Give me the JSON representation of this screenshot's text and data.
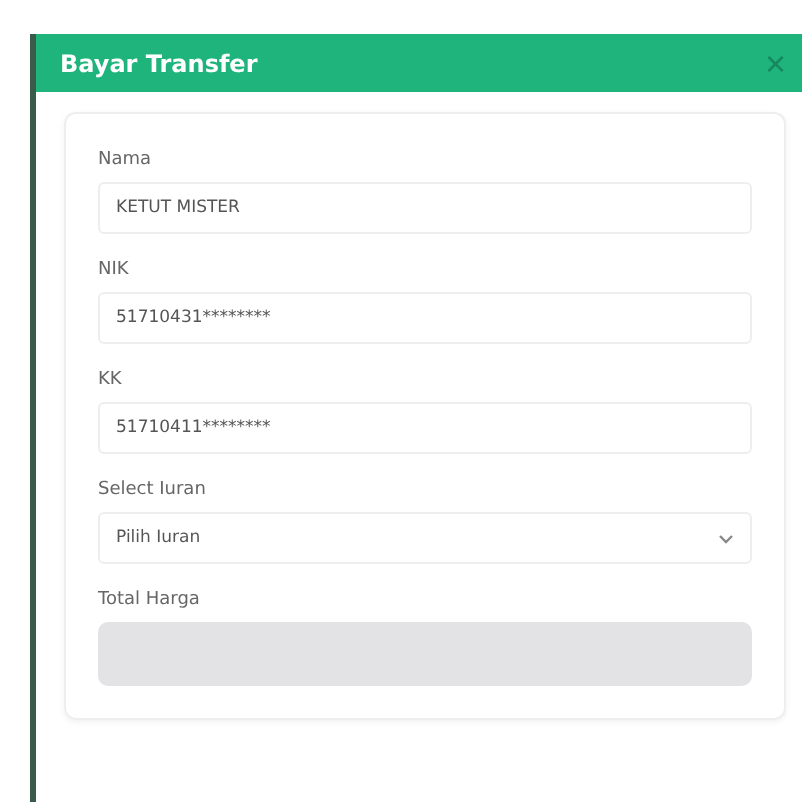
{
  "modal": {
    "title": "Bayar Transfer",
    "close": "×"
  },
  "fields": [
    {
      "kind": "text",
      "label": "Nama",
      "value": "KETUT MISTER"
    },
    {
      "kind": "text",
      "label": "NIK",
      "value": "51710431********"
    },
    {
      "kind": "text",
      "label": "KK",
      "value": "51710411********"
    },
    {
      "kind": "select",
      "label": "Select Iuran",
      "placeholder": "Pilih Iuran"
    },
    {
      "kind": "disabled",
      "label": "Total Harga"
    }
  ]
}
